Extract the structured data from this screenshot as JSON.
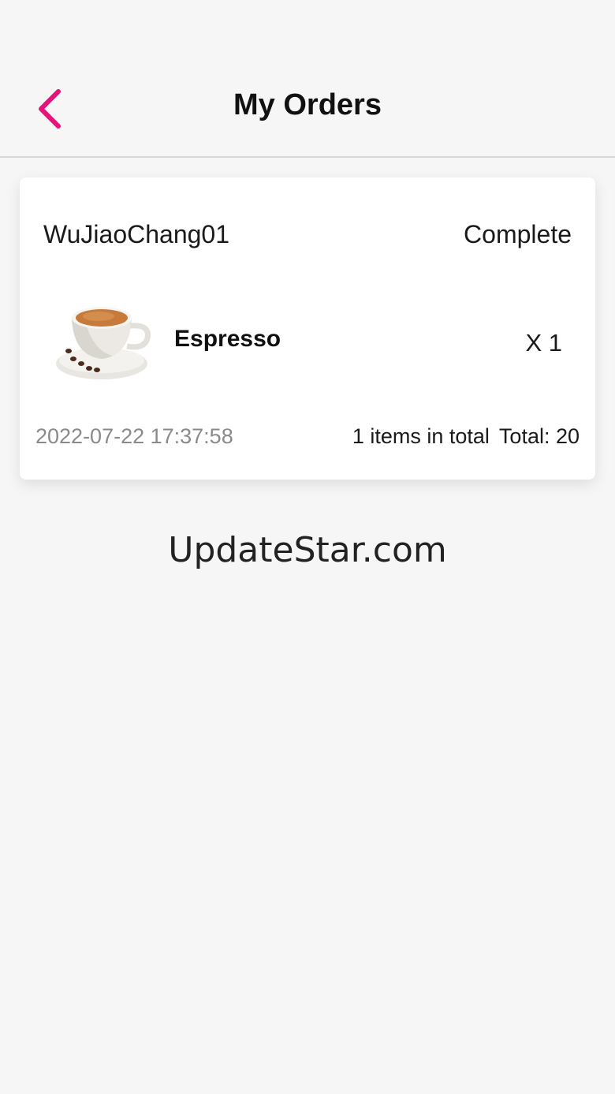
{
  "header": {
    "title": "My Orders",
    "back_icon": "chevron-left-icon",
    "accent_color": "#e5137a"
  },
  "order": {
    "store_name": "WuJiaoChang01",
    "status": "Complete",
    "item": {
      "name": "Espresso",
      "quantity": "X 1",
      "image_icon": "espresso-cup-image"
    },
    "datetime": "2022-07-22 17:37:58",
    "items_count_text": "1 items in total",
    "total_text": "Total: 20"
  },
  "watermark": "UpdateStar.com"
}
